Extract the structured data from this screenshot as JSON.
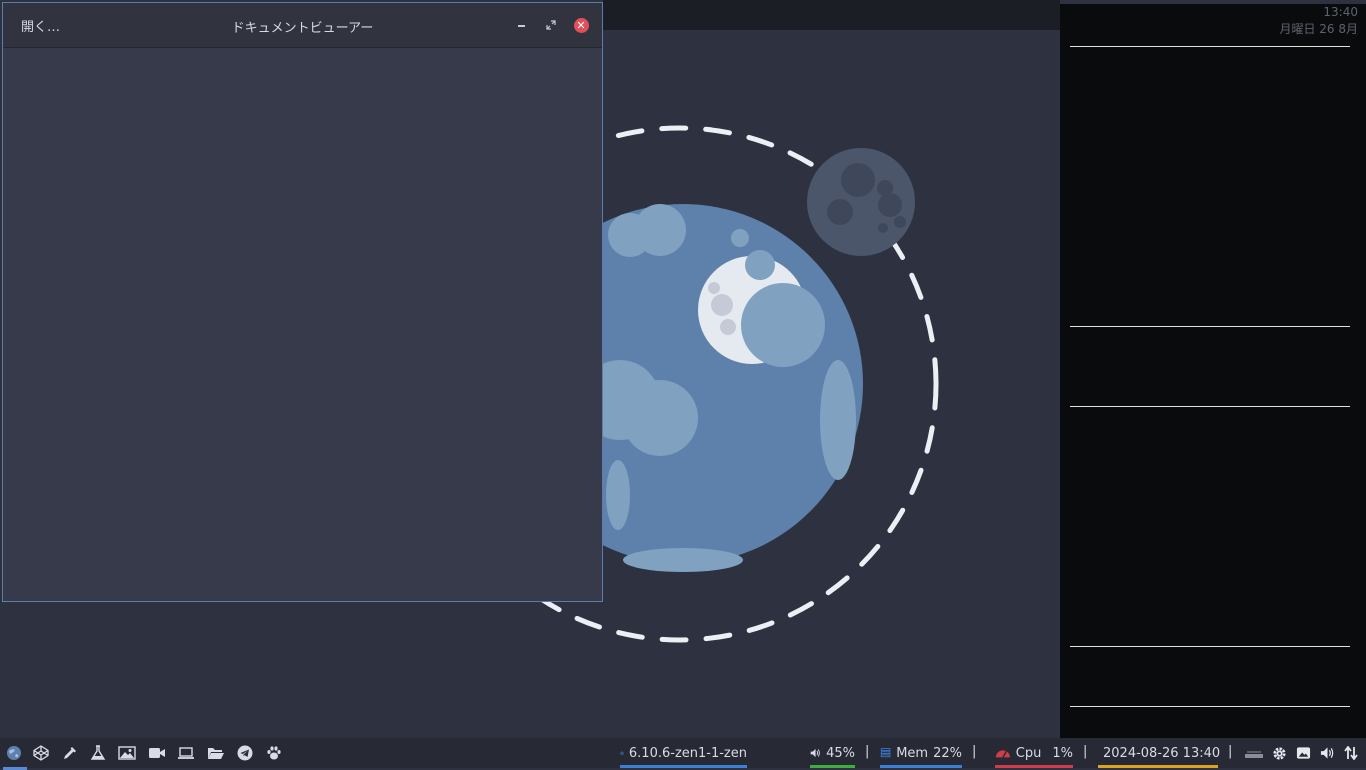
{
  "window": {
    "title": "ドキュメントビューアー",
    "open_button": "開く…",
    "close_glyph": "✕"
  },
  "side_panel": {
    "time": "13:40",
    "date": "月曜日 26 8月"
  },
  "taskbar": {
    "launchers": [
      {
        "icon": "globe-icon",
        "active": true
      },
      {
        "icon": "codepen-icon"
      },
      {
        "icon": "color-picker-icon"
      },
      {
        "icon": "flask-icon"
      },
      {
        "icon": "image-viewer-icon"
      },
      {
        "icon": "video-camera-icon"
      },
      {
        "icon": "laptop-icon"
      },
      {
        "icon": "folder-open-icon"
      },
      {
        "icon": "telegram-icon"
      },
      {
        "icon": "paw-icon"
      }
    ],
    "kernel": "6.10.6-zen1-1-zen",
    "volume": "45%",
    "memory_label": "Mem",
    "memory_value": "22%",
    "cpu_label": "Cpu",
    "cpu_value": "1%",
    "datetime": "2024-08-26 13:40",
    "separator": "|",
    "colors": {
      "kernel": "#3b7fd6",
      "volume": "#3fae3f",
      "memory": "#3b7fd6",
      "cpu": "#d23b4a",
      "date": "#d9a520"
    }
  }
}
